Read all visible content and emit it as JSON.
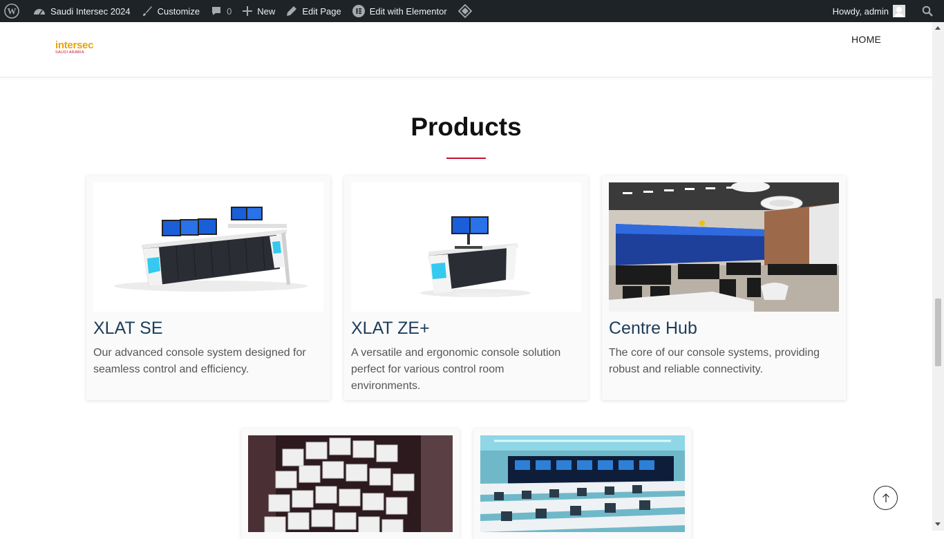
{
  "admin_bar": {
    "site_name": "Saudi Intersec 2024",
    "customize": "Customize",
    "comments_count": "0",
    "new": "New",
    "edit_page": "Edit Page",
    "edit_elementor": "Edit with Elementor",
    "howdy": "Howdy, admin"
  },
  "header": {
    "logo_main": "intersec",
    "logo_sub": "SAUDI ARABIA",
    "nav_home": "HOME"
  },
  "products": {
    "title": "Products",
    "items": [
      {
        "name": "XLAT SE",
        "description": "Our advanced console system designed for seamless control and efficiency."
      },
      {
        "name": "XLAT ZE+",
        "description": "A versatile and ergonomic console solution perfect for various control room environments."
      },
      {
        "name": "Centre Hub",
        "description": "The core of our console systems, providing robust and reliable connectivity."
      }
    ]
  },
  "colors": {
    "admin_bar_bg": "#1d2327",
    "heading_blue": "#1c3d5a",
    "accent_red": "#c8102e",
    "logo_gold": "#e8a400"
  }
}
